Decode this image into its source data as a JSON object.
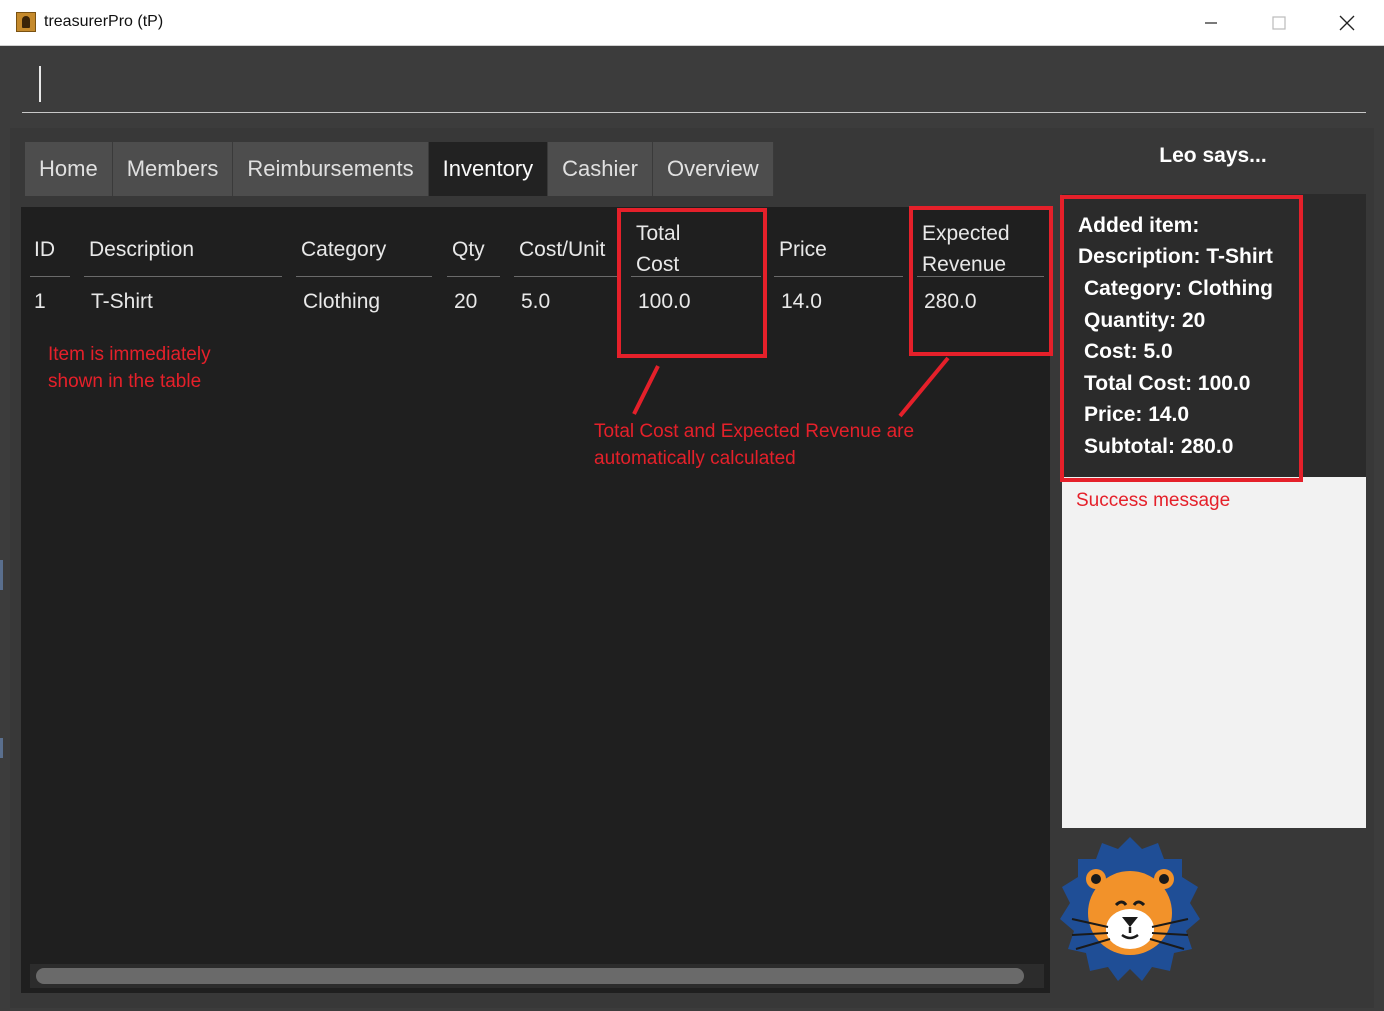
{
  "window": {
    "title": "treasurerPro (tP)",
    "minimize_icon": "minimize-icon",
    "maximize_icon": "maximize-icon",
    "close_icon": "close-icon"
  },
  "command": {
    "value": ""
  },
  "tabs": [
    {
      "label": "Home",
      "active": false
    },
    {
      "label": "Members",
      "active": false
    },
    {
      "label": "Reimbursements",
      "active": false
    },
    {
      "label": "Inventory",
      "active": true
    },
    {
      "label": "Cashier",
      "active": false
    },
    {
      "label": "Overview",
      "active": false
    }
  ],
  "table": {
    "headers": [
      "ID",
      "Description",
      "Category",
      "Qty",
      "Cost/Unit",
      "Total\nCost",
      "Price",
      "Expected\nRevenue"
    ],
    "rows": [
      [
        "1",
        "T-Shirt",
        "Clothing",
        "20",
        "5.0",
        "100.0",
        "14.0",
        "280.0"
      ]
    ]
  },
  "leo": {
    "title": "Leo says...",
    "message_lines": [
      "Added item:",
      "Description: T-Shirt",
      "Category: Clothing",
      "Quantity: 20",
      "Cost: 5.0",
      "Total Cost: 100.0",
      "Price: 14.0",
      "Subtotal: 280.0"
    ],
    "mascot_icon": "lion-mascot-icon"
  },
  "annotations": {
    "table_note": [
      "Item is immediately",
      "shown in the table"
    ],
    "calc_note": [
      "Total Cost and Expected Revenue are",
      "automatically calculated"
    ],
    "success_note": "Success message",
    "color": "#e5202a"
  },
  "colors": {
    "background": "#3c3c3c",
    "table_background": "#1f1f1f",
    "active_tab": "#222222",
    "tab": "#4d4d4d",
    "message_dark": "#2b2b2b",
    "message_light": "#f2f2f2"
  }
}
